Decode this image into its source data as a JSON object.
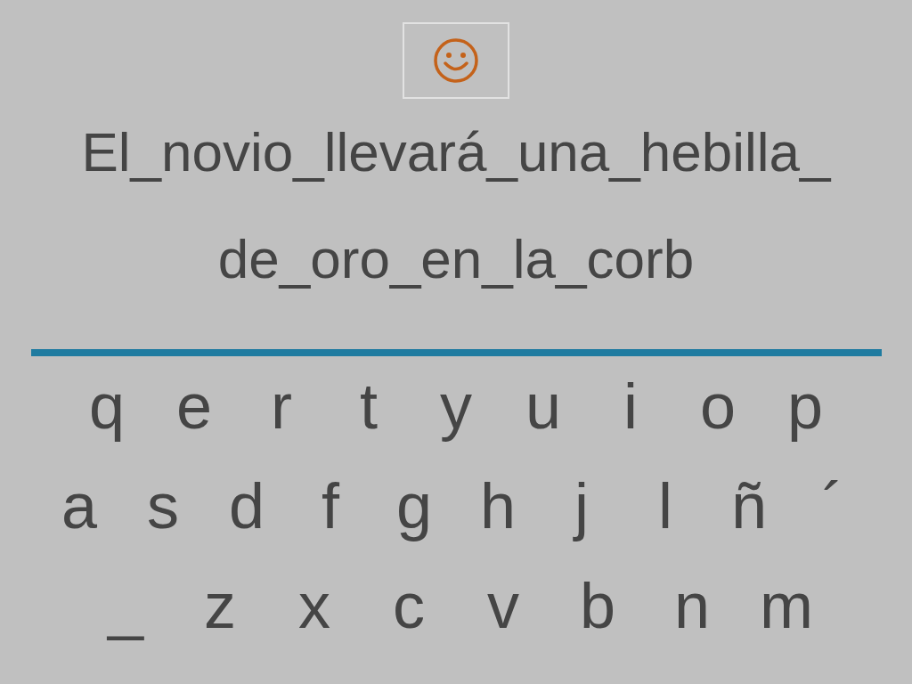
{
  "sentence_lines": [
    "El_novio_llevará_una_hebilla_",
    "de_oro_en_la_corb"
  ],
  "keyboard": {
    "rows": [
      [
        "q",
        "e",
        "r",
        "t",
        "y",
        "u",
        "i",
        "o",
        "p"
      ],
      [
        "a",
        "s",
        "d",
        "f",
        "g",
        "h",
        "j",
        "l",
        "ñ",
        "´"
      ],
      [
        "_",
        "z",
        "x",
        "c",
        "v",
        "b",
        "n",
        "m"
      ]
    ]
  }
}
